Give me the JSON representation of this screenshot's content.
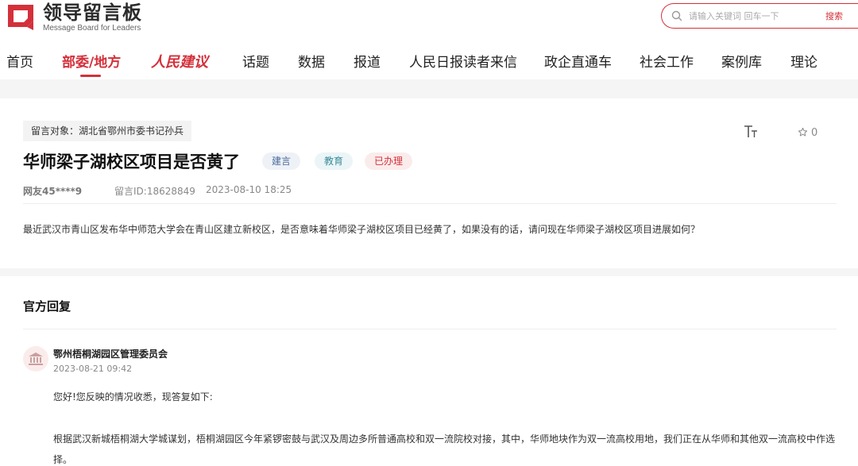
{
  "brand": {
    "name_cn": "领导留言板",
    "name_en": "Message Board for Leaders",
    "color": "#d4303a"
  },
  "search": {
    "placeholder": "请输入关键词 回车一下",
    "button_label": "搜索",
    "icon": "search-icon"
  },
  "nav": {
    "items": [
      {
        "label": "首页"
      },
      {
        "label": "部委/地方",
        "active": true
      },
      {
        "label": "人民建议"
      },
      {
        "label": "话题"
      },
      {
        "label": "数据"
      },
      {
        "label": "报道"
      },
      {
        "label": "人民日报读者来信"
      },
      {
        "label": "政企直通车"
      },
      {
        "label": "社会工作"
      },
      {
        "label": "案例库"
      },
      {
        "label": "理论"
      }
    ]
  },
  "message": {
    "target": "留言对象：湖北省鄂州市委书记孙兵",
    "title": "华师梁子湖校区项目是否黄了",
    "badges": {
      "type": "建言",
      "field": "教育",
      "status": "已办理"
    },
    "user": "网友45****9",
    "id": "留言ID:18628849",
    "time": "2023-08-10 18:25",
    "body": "最近武汉市青山区发布华中师范大学会在青山区建立新校区，是否意味着华师梁子湖校区项目已经黄了，如果没有的话，请问现在华师梁子湖校区项目进展如何？",
    "font_size_icon": "text-size-icon",
    "favorite_icon": "star-icon",
    "favorite_count": "0"
  },
  "reply": {
    "heading": "官方回复",
    "org_icon": "government-building-icon",
    "org_name": "鄂州梧桐湖园区管理委员会",
    "time": "2023-08-21 09:42",
    "greeting": "您好!您反映的情况收悉，现答复如下:",
    "content": "根据武汉新城梧桐湖大学城谋划，梧桐湖园区今年紧锣密鼓与武汉及周边多所普通高校和双一流院校对接，其中，华师地块作为双一流高校用地，我们正在从华师和其他双一流高校中作选择。"
  }
}
